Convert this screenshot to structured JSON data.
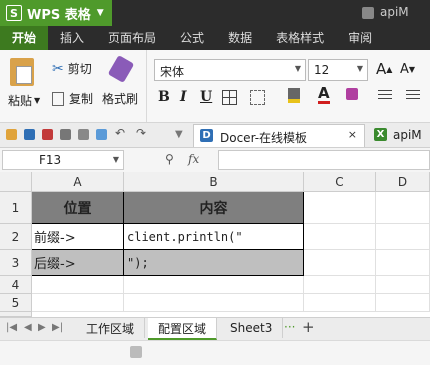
{
  "title_bar": {
    "app_button_label": "WPS 表格",
    "app_letter": "S",
    "window_label": "apiM"
  },
  "menu": {
    "items": [
      "开始",
      "插入",
      "页面布局",
      "公式",
      "数据",
      "表格样式",
      "审阅"
    ]
  },
  "ribbon": {
    "paste_label": "粘贴",
    "cut_label": "剪切",
    "copy_label": "复制",
    "format_painter_label": "格式刷",
    "font_name": "宋体",
    "font_size": "12",
    "bold": "B",
    "italic": "I",
    "underline": "U",
    "grow_font": "A",
    "shrink_font": "A"
  },
  "quick_access": {
    "doc_tab_label": "Docer-在线模板",
    "doc_tab_letter": "D",
    "close_glyph": "×",
    "second_tab_label": "apiM"
  },
  "formula_bar": {
    "cell_ref": "F13",
    "fx_label": "fx",
    "value": ""
  },
  "sheet": {
    "columns": [
      "A",
      "B",
      "C",
      "D"
    ],
    "rows": [
      "1",
      "2",
      "3",
      "4",
      "5"
    ],
    "cells": {
      "a1": "位置",
      "b1": "内容",
      "a2": "前缀->",
      "b2": "client.println(\"",
      "a3": "后缀->",
      "b3": "\");"
    }
  },
  "sheet_tabs": {
    "tabs": [
      "工作区域",
      "配置区域",
      "Sheet3"
    ],
    "active": "配置区域",
    "more": "···",
    "add": "+"
  },
  "colors": {
    "wps_green": "#4f9a2b",
    "header_dark": "#7f7f7f",
    "row_gray": "#bfbfbf"
  }
}
